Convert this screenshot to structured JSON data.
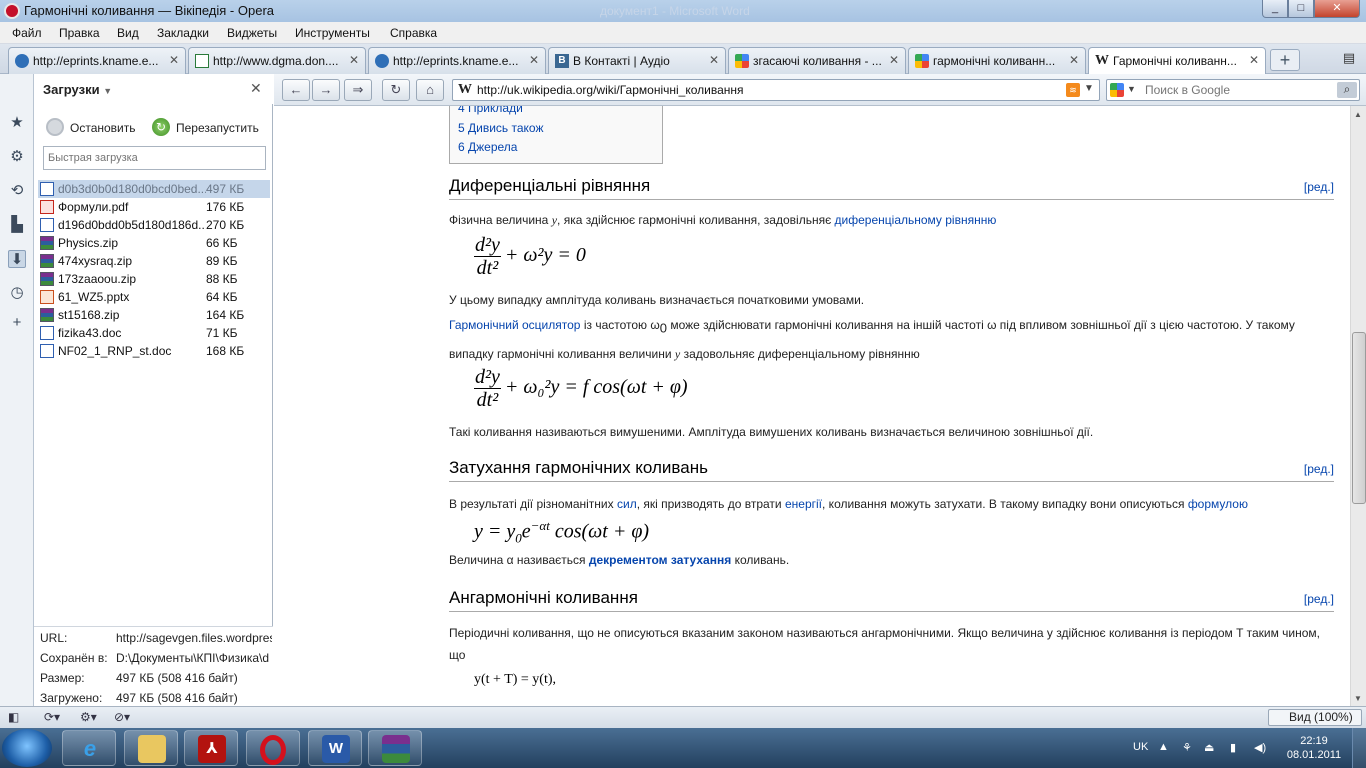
{
  "window": {
    "title": "Гармонічні коливання — Вікіпедія - Opera",
    "ghost_title": "документ1 - Microsoft Word"
  },
  "menu": [
    "Файл",
    "Правка",
    "Вид",
    "Закладки",
    "Виджеты",
    "Инструменты",
    "Справка"
  ],
  "tabs": [
    {
      "label": "http://eprints.kname.e...",
      "icon": "page-icon"
    },
    {
      "label": "http://www.dgma.don....",
      "icon": "page-icon"
    },
    {
      "label": "http://eprints.kname.e...",
      "icon": "page-icon"
    },
    {
      "label": "В Контакті | Аудіо",
      "icon": "vk-icon"
    },
    {
      "label": "згасаючі коливання - ...",
      "icon": "google-icon"
    },
    {
      "label": "гармонічні коливанн...",
      "icon": "google-icon"
    },
    {
      "label": "Гармонічні коливанн...",
      "icon": "wikipedia-icon",
      "active": true
    }
  ],
  "downloads": {
    "title": "Загрузки",
    "stop_label": "Остановить",
    "restart_label": "Перезапустить",
    "quick_placeholder": "Быстрая загрузка",
    "files": [
      {
        "name": "d0b3d0b0d180d0bcd0bed...",
        "size": "497 КБ",
        "type": "doc",
        "selected": true
      },
      {
        "name": "Формули.pdf",
        "size": "176 КБ",
        "type": "pdf"
      },
      {
        "name": "d196d0bdd0b5d180d186d...",
        "size": "270 КБ",
        "type": "doc"
      },
      {
        "name": "Physics.zip",
        "size": "66 КБ",
        "type": "zip"
      },
      {
        "name": "474xysraq.zip",
        "size": "89 КБ",
        "type": "zip"
      },
      {
        "name": "173zaaoou.zip",
        "size": "88 КБ",
        "type": "zip"
      },
      {
        "name": "61_WZ5.pptx",
        "size": "64 КБ",
        "type": "ppt"
      },
      {
        "name": "st15168.zip",
        "size": "164 КБ",
        "type": "zip"
      },
      {
        "name": "fizika43.doc",
        "size": "71 КБ",
        "type": "doc"
      },
      {
        "name": "NF02_1_RNP_st.doc",
        "size": "168 КБ",
        "type": "doc"
      }
    ],
    "details": [
      {
        "label": "URL:",
        "value": "http://sagevgen.files.wordpress.com"
      },
      {
        "label": "Сохранён в:",
        "value": "D:\\Документы\\КПІ\\Физика\\d"
      },
      {
        "label": "Размер:",
        "value": "497 КБ (508 416 байт)"
      },
      {
        "label": "Загружено:",
        "value": "497 КБ (508 416 байт)"
      }
    ]
  },
  "address": {
    "url": "http://uk.wikipedia.org/wiki/Гармонічні_коливання",
    "search_placeholder": "Поиск в Google"
  },
  "article": {
    "toc": [
      "4 Приклади",
      "5 Дивись також",
      "6 Джерела"
    ],
    "edit_label": "[ред.]",
    "s1_title": "Диференціальні рівняння",
    "p1_a": "Фізична величина",
    "p1_var": "y",
    "p1_b": ", яка здійснює гармонічні коливання, задовільняє",
    "p1_link": "диференціальному рівнянню",
    "f1_num": "d²y",
    "f1_den": "dt²",
    "f1_rest": "+ ω²y = 0",
    "p2": "У цьому випадку амплітуда коливань визначається початковими умовами.",
    "p3_link": "Гармонічний осцилятор",
    "p3_a": "із частотою ω",
    "p3_sub": "0",
    "p3_b": "може здійснювати гармонічні коливання на іншій частоті ω під впливом зовнішньої дії з цією частотою. У такому випадку гармонічні коливання величини",
    "p3_var": "y",
    "p3_c": "задоволь­няє диференціальному рівнянню",
    "f2_num": "d²y",
    "f2_den": "dt²",
    "f2_rest": "+ ω₀²y = f cos(ωt + φ)",
    "p4": "Такі коливання називаються вимушеними. Амплітуда вимушених коливань визначається величиною зовнішньої дії.",
    "s2_title": "Затухання гармонічних коливань",
    "p5_a": "В результаті дії різноманітних",
    "p5_l1": "сил",
    "p5_b": ", які призводять до втрати",
    "p5_l2": "енергії",
    "p5_c": ", коливання можуть затухати. В такому випадку вони описуються",
    "p5_l3": "формулою",
    "f3": "y = y₀e^(−αt) cos(ωt + φ)",
    "f3_base": "y = y",
    "f3_sub": "0",
    "f3_e": "e",
    "f3_sup": "−αt",
    "f3_tail": "cos(ωt + φ)",
    "p6_a": "Величина α називається",
    "p6_link": "декрементом затухання",
    "p6_b": "коливань.",
    "s3_title": "Ангармонічні коливання",
    "p7": "Періодичні коливання, що не описуються вказаним законом називаються ангармонічними. Якщо величина y здійснює коливання із періодом T таким чином, що",
    "f4": "y(t + T) = y(t),"
  },
  "status": {
    "zoom": "Вид (100%)"
  },
  "taskbar": {
    "lang": "UK",
    "time": "22:19",
    "date": "08.01.2011"
  },
  "colors": {
    "link": "#0645ad",
    "opera_red": "#c4102a"
  }
}
